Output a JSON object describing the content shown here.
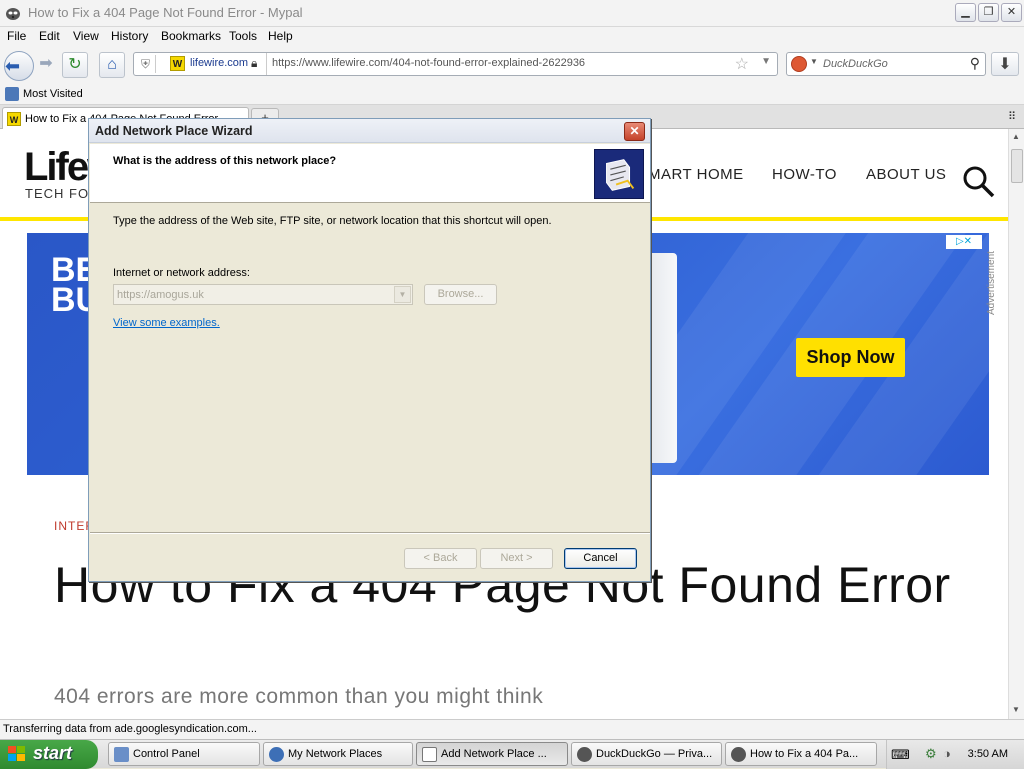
{
  "browser": {
    "window_title": "How to Fix a 404 Page Not Found Error - Mypal",
    "menu": [
      "File",
      "Edit",
      "View",
      "History",
      "Bookmarks",
      "Tools",
      "Help"
    ],
    "url_domain_badge": "lifewire.com",
    "url": "https://www.lifewire.com/404-not-found-error-explained-2622936",
    "search_engine": "DuckDuckGo",
    "bookmark": "Most Visited",
    "tab_title": "How to Fix a 404 Page Not Found Error",
    "new_tab": "+",
    "status": "Transferring data from ade.googlesyndication.com..."
  },
  "page": {
    "logo": "Lifew",
    "tagline": "TECH FOR",
    "nav": [
      "MART HOME",
      "HOW-TO",
      "ABOUT US"
    ],
    "ad": {
      "brand_line1": "BE",
      "brand_line2": "BU",
      "cta": "Shop Now",
      "side_label": "Advertisement"
    },
    "category": "INTER",
    "headline": "How to Fix a 404 Page Not Found Error",
    "subheadline": "404 errors are more common than you might think"
  },
  "wizard": {
    "title": "Add Network Place Wizard",
    "question": "What is the address of this network place?",
    "description": "Type the address of the Web site, FTP site, or network location that this shortcut will open.",
    "address_label": "Internet or network address:",
    "address_value": "https://amogus.uk",
    "browse": "Browse...",
    "examples_link": "View some examples.",
    "back": "< Back",
    "next": "Next >",
    "cancel": "Cancel"
  },
  "taskbar": {
    "start": "start",
    "tasks": [
      "Control Panel",
      "My Network Places",
      "Add Network Place ...",
      "DuckDuckGo — Priva...",
      "How to Fix a 404 Pa..."
    ],
    "clock": "3:50 AM"
  },
  "colors": {
    "brand_yellow": "#ffe600",
    "ad_blue": "#2e5fd1",
    "link_blue": "#0066cc",
    "xp_green": "#3c9a3c"
  }
}
